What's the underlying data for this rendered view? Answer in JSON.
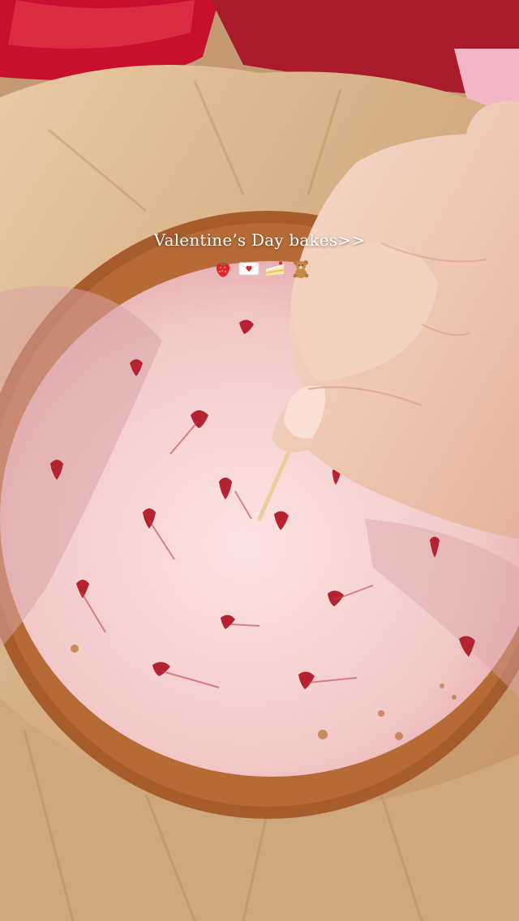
{
  "overlay": {
    "caption": "Valentine’s Day bakes>>",
    "emojis": [
      "strawberry-icon",
      "love-letter-icon",
      "cake-slice-icon",
      "teddy-bear-icon"
    ]
  },
  "colors": {
    "filling": "#f3c9c9",
    "swirl": "#b4232f",
    "crust": "#b86a37",
    "parchment": "#d9b58e",
    "skin": "#f1c9b4"
  }
}
